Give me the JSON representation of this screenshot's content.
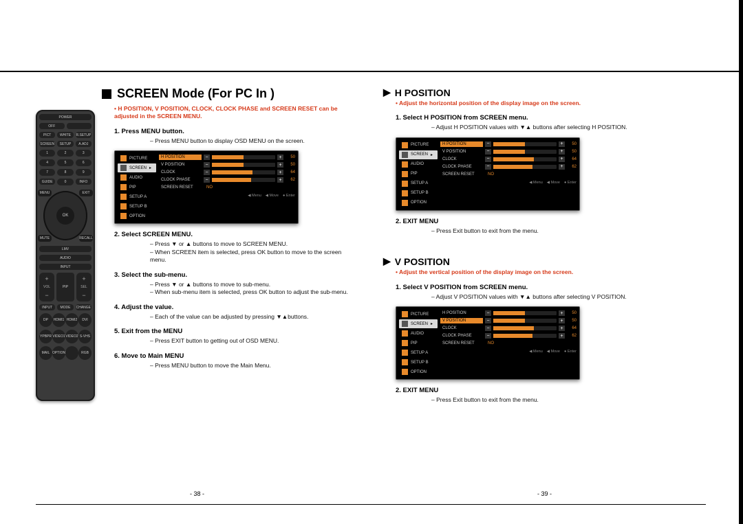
{
  "pageLeftNum": "- 38 -",
  "pageRightNum": "- 39 -",
  "left": {
    "title": "SCREEN Mode (For PC In )",
    "note": "H POSITION, V POSITION, CLOCK, CLOCK PHASE and SCREEN RESET can be adjusted in the SCREEN MENU.",
    "steps": [
      {
        "head": "1.   Press MENU button.",
        "body": [
          "Press MENU button to display OSD MENU on the screen."
        ]
      },
      {
        "head": "2.   Select SCREEN MENU.",
        "body": [
          "Press ▼ or ▲ buttons to move to SCREEN MENU.",
          "When SCREEN item is selected, press OK button to move to the screen menu."
        ]
      },
      {
        "head": "3.   Select the sub-menu.",
        "body": [
          "Press ▼ or ▲ buttons to move to sub-menu.",
          "When sub-menu item is selected, press OK button to adjust the sub-menu."
        ]
      },
      {
        "head": "4.   Adjust the value.",
        "body": [
          "Each of the value can be adjusted by pressing ▼▲buttons."
        ]
      },
      {
        "head": "5.   Exit from the MENU",
        "body": [
          "Press EXIT button to getting out of OSD MENU."
        ]
      },
      {
        "head": "6.   Move to Main MENU",
        "body": [
          "Press MENU button to move the Main Menu."
        ]
      }
    ]
  },
  "right": {
    "sections": [
      {
        "title": "H POSITION",
        "note": "Adjust the horizontal position of the display image on the screen.",
        "steps": [
          {
            "head": "1.   Select H POSITION from SCREEN menu.",
            "body": [
              "Adjust H POSITION values with ▼▲ buttons after selecting H POSITION."
            ]
          },
          {
            "head": "2.   EXIT MENU",
            "body": [
              "Press Exit button to exit from the menu."
            ]
          }
        ],
        "osdHighlight": 0
      },
      {
        "title": "V POSITION",
        "note": "Adjust the vertical position of the display image on the screen.",
        "steps": [
          {
            "head": "1.   Select V POSITION from SCREEN menu.",
            "body": [
              "Adjust V POSITION values with ▼▲ buttons after selecting V POSITION."
            ]
          },
          {
            "head": "2.   EXIT MENU",
            "body": [
              "Press Exit button to exit from the menu."
            ]
          }
        ],
        "osdHighlight": 1
      }
    ]
  },
  "osd": {
    "tabs": [
      "PICTURE",
      "SCREEN",
      "AUDIO",
      "PIP",
      "SETUP A",
      "SETUP B",
      "OPTION"
    ],
    "tabIcons": [
      "orange",
      "gray",
      "orange",
      "orange",
      "orange",
      "orange",
      "orange"
    ],
    "rows": [
      {
        "label": "H POSITION",
        "val": "50",
        "pct": 50
      },
      {
        "label": "V POSITION",
        "val": "50",
        "pct": 50
      },
      {
        "label": "CLOCK",
        "val": "64",
        "pct": 64
      },
      {
        "label": "CLOCK PHASE",
        "val": "62",
        "pct": 62
      }
    ],
    "resetLabel": "SCREEN RESET",
    "resetValue": "NO",
    "footer": [
      "◀ Menu",
      "◀ Move",
      "● Enter"
    ]
  },
  "remote": {
    "power": "POWER",
    "row1": [
      "OFF",
      ""
    ],
    "row2": [
      "PICT",
      "WHITE",
      "R.SETUP"
    ],
    "row3": [
      "SCREEN",
      "SETUP",
      "A.ADJ"
    ],
    "numbers": [
      "1",
      "2",
      "3",
      "4",
      "5",
      "6",
      "7",
      "8",
      "9"
    ],
    "row7": [
      "GUIDE",
      "0",
      "INFO"
    ],
    "cornerTL": "MENU",
    "cornerTR": "EXIT",
    "cornerBL": "MUTE",
    "cornerBR": "RECALL",
    "ok": "OK",
    "mid1": "LMV",
    "mid2": "AUDIO",
    "mid3": "INPUT",
    "rockL": "VOL",
    "rockR": "SEL",
    "midPip": "PIP",
    "rowA": [
      "INPUT",
      "MODE",
      "CHANGE"
    ],
    "circles1": [
      "DP",
      "HDMI1",
      "HDMI2",
      "DVI"
    ],
    "circles2": [
      "YPBPR",
      "VIDEO1",
      "VIDEO2",
      "S-VHS"
    ],
    "circles3": [
      "MAIL",
      "OPTION",
      "",
      "RGB"
    ]
  }
}
